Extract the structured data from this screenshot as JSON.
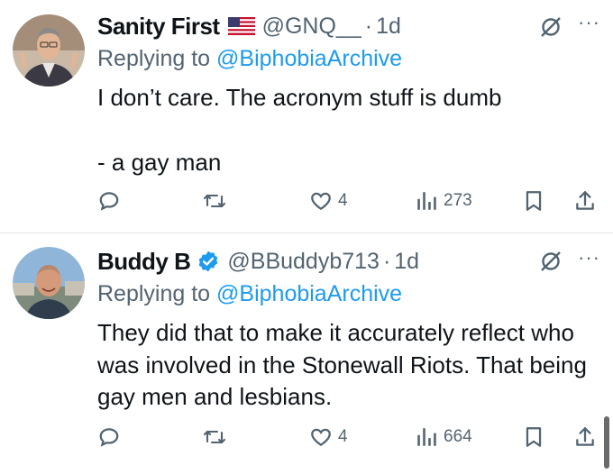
{
  "tweets": [
    {
      "name": "Sanity First",
      "handle": "@GNQ__",
      "time": "1d",
      "replying_prefix": "Replying to ",
      "replying_to": "@BiphobiaArchive",
      "paragraphs": [
        "I don’t care. The acronym stuff is dumb",
        "- a gay man"
      ],
      "reply_count": "",
      "retweet_count": "",
      "like_count": "4",
      "view_count": "273",
      "badge": "us-flag-emoji"
    },
    {
      "name": "Buddy B",
      "handle": "@BBuddyb713",
      "time": "1d",
      "replying_prefix": "Replying to ",
      "replying_to": "@BiphobiaArchive",
      "paragraphs": [
        "They did that to make it accurately reflect who was involved in the Stonewall Riots.  That being gay men and lesbians."
      ],
      "reply_count": "",
      "retweet_count": "",
      "like_count": "4",
      "view_count": "664",
      "badge": "verified-check"
    }
  ],
  "separator": "·",
  "more_label": "···",
  "colors": {
    "accent": "#1d9bf0",
    "secondary_text": "#536471",
    "text": "#0f1419",
    "divider": "#e4e8ec"
  }
}
